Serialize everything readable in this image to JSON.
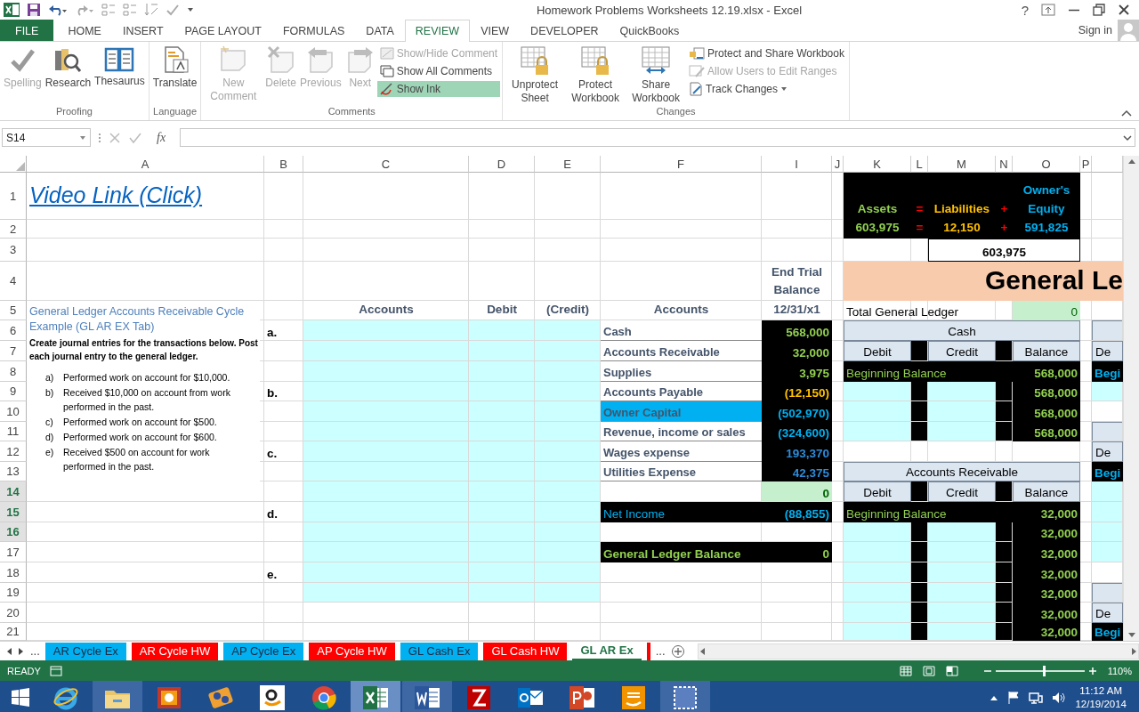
{
  "title_bar": {
    "title": "Homework Problems Worksheets 12.19.xlsx - Excel",
    "help": "?"
  },
  "tabs": [
    {
      "label": "FILE",
      "kind": "file",
      "selected": false
    },
    {
      "label": "HOME",
      "kind": "tab",
      "selected": false
    },
    {
      "label": "INSERT",
      "kind": "tab",
      "selected": false
    },
    {
      "label": "PAGE LAYOUT",
      "kind": "tab",
      "selected": false
    },
    {
      "label": "FORMULAS",
      "kind": "tab",
      "selected": false
    },
    {
      "label": "DATA",
      "kind": "tab",
      "selected": false
    },
    {
      "label": "REVIEW",
      "kind": "tab",
      "selected": true
    },
    {
      "label": "VIEW",
      "kind": "tab",
      "selected": false
    },
    {
      "label": "DEVELOPER",
      "kind": "tab",
      "selected": false
    },
    {
      "label": "QuickBooks",
      "kind": "tab",
      "selected": false
    }
  ],
  "account": {
    "sign_in": "Sign in"
  },
  "ribbon_groups": [
    {
      "label": "Proofing",
      "items": [
        {
          "kind": "large",
          "label": "Spelling",
          "disabled": true
        },
        {
          "kind": "large",
          "label": "Research",
          "disabled": false
        },
        {
          "kind": "large",
          "label": "Thesaurus",
          "disabled": false
        }
      ]
    },
    {
      "label": "Language",
      "items": [
        {
          "kind": "large",
          "label": "Translate",
          "disabled": false
        }
      ]
    },
    {
      "label": "Comments",
      "items": [
        {
          "kind": "large",
          "label": "New Comment",
          "disabled": true
        },
        {
          "kind": "large",
          "label": "Delete",
          "disabled": true
        },
        {
          "kind": "large",
          "label": "Previous",
          "disabled": true
        },
        {
          "kind": "large",
          "label": "Next",
          "disabled": true
        },
        {
          "kind": "stack",
          "items": [
            {
              "label": "Show/Hide Comment",
              "disabled": true,
              "selected": false
            },
            {
              "label": "Show All Comments",
              "disabled": false,
              "selected": false
            },
            {
              "label": "Show Ink",
              "disabled": false,
              "selected": true
            }
          ]
        }
      ]
    },
    {
      "label": "Changes",
      "items": [
        {
          "kind": "large",
          "label": "Unprotect Sheet",
          "disabled": false
        },
        {
          "kind": "large",
          "label": "Protect Workbook",
          "disabled": false
        },
        {
          "kind": "large",
          "label": "Share Workbook",
          "disabled": false
        },
        {
          "kind": "stack",
          "items": [
            {
              "label": "Protect and Share Workbook",
              "disabled": false,
              "selected": false
            },
            {
              "label": "Allow Users to Edit Ranges",
              "disabled": true,
              "selected": false
            },
            {
              "label": "Track Changes",
              "disabled": false,
              "selected": false,
              "dropdown": true
            }
          ]
        }
      ]
    }
  ],
  "formula_bar": {
    "name_box": "S14",
    "function_label": "fx"
  },
  "sheet": {
    "columns": [
      "A",
      "B",
      "C",
      "D",
      "E",
      "F",
      "I",
      "J",
      "K",
      "L",
      "M",
      "N",
      "O",
      "P"
    ],
    "rows": [
      {
        "label": "1",
        "selected": false
      },
      {
        "label": "2",
        "selected": false
      },
      {
        "label": "3",
        "selected": false
      },
      {
        "label": "4",
        "selected": false
      },
      {
        "label": "5",
        "selected": false
      },
      {
        "label": "6",
        "selected": false
      },
      {
        "label": "7",
        "selected": false
      },
      {
        "label": "8",
        "selected": false
      },
      {
        "label": "9",
        "selected": false
      },
      {
        "label": "10",
        "selected": false
      },
      {
        "label": "11",
        "selected": false
      },
      {
        "label": "12",
        "selected": false
      },
      {
        "label": "13",
        "selected": false
      },
      {
        "label": "14",
        "selected": true
      },
      {
        "label": "15",
        "selected": true
      },
      {
        "label": "16",
        "selected": true
      },
      {
        "label": "17",
        "selected": false
      },
      {
        "label": "18",
        "selected": false
      },
      {
        "label": "19",
        "selected": false
      },
      {
        "label": "20",
        "selected": false
      },
      {
        "label": "21",
        "selected": false
      }
    ],
    "video_link": "Video Link (Click)",
    "text_box": {
      "title": "General Ledger Accounts Receivable Cycle Example (GL AR EX Tab)",
      "intro": "Create journal entries for the transactions below. Post each journal entry to the general ledger.",
      "items": [
        {
          "marker": "a)",
          "text": "Performed work on account for $10,000."
        },
        {
          "marker": "b)",
          "text": "Received $10,000 on account from work performed in the past."
        },
        {
          "marker": "c)",
          "text": "Performed work on account for $500."
        },
        {
          "marker": "d)",
          "text": "Performed work on account for $600."
        },
        {
          "marker": "e)",
          "text": "Received $500 on account for work performed in the past."
        }
      ]
    },
    "equation": {
      "terms": [
        {
          "label": "Assets",
          "value": "603,975",
          "kind": "asset"
        },
        {
          "label": "=",
          "value": "=",
          "kind": "operator"
        },
        {
          "label": "Liabilities",
          "value": "12,150",
          "kind": "liability"
        },
        {
          "label": "+",
          "value": "+",
          "kind": "operator"
        },
        {
          "label": "Owner's Equity",
          "value": "591,825",
          "kind": "equity"
        }
      ],
      "total": "603,975"
    },
    "journal": {
      "headers": [
        "Accounts",
        "Debit",
        "(Credit)"
      ],
      "entries": [
        "a.",
        "b.",
        "c.",
        "d.",
        "e."
      ]
    },
    "trial_balance": {
      "title": "End Trial Balance",
      "accounts_header": "Accounts",
      "date": "12/31/x1",
      "accounts": [
        {
          "name": "Cash",
          "amount": "568,000",
          "kind": "asset",
          "highlighted": false
        },
        {
          "name": "Accounts Receivable",
          "amount": "32,000",
          "kind": "asset",
          "highlighted": false
        },
        {
          "name": "Supplies",
          "amount": "3,975",
          "kind": "asset",
          "highlighted": false
        },
        {
          "name": "Accounts Payable",
          "amount": "(12,150)",
          "kind": "liability",
          "highlighted": false
        },
        {
          "name": "Owner Capital",
          "amount": "(502,970)",
          "kind": "equity",
          "highlighted": true
        },
        {
          "name": "Revenue, income or sales",
          "amount": "(324,600)",
          "kind": "equity",
          "highlighted": false
        },
        {
          "name": "Wages expense",
          "amount": "193,370",
          "kind": "expense",
          "highlighted": false
        },
        {
          "name": "Utilities Expense",
          "amount": "42,375",
          "kind": "expense",
          "highlighted": false
        }
      ],
      "check": "0",
      "net_income": {
        "label": "Net Income",
        "amount": "(88,855)"
      },
      "balance": {
        "label": "General Ledger Balance",
        "amount": "0"
      }
    },
    "ledger": {
      "title": "General Le",
      "total_label": "Total General Ledger",
      "total": "0",
      "accounts": [
        {
          "name": "Cash",
          "columns": [
            "Debit",
            "Credit",
            "Balance"
          ],
          "opening_label": "Beginning Balance",
          "balances": [
            "568,000",
            "568,000",
            "568,000",
            "568,000"
          ]
        },
        {
          "name": "Accounts Receivable",
          "columns": [
            "Debit",
            "Credit",
            "Balance"
          ],
          "opening_label": "Beginning Balance",
          "balances": [
            "32,000",
            "32,000",
            "32,000",
            "32,000",
            "32,000",
            "32,000",
            "32,000"
          ]
        }
      ],
      "edge_cells": [
        {
          "kind": "header"
        },
        {
          "kind": "column",
          "text": "De"
        },
        {
          "kind": "opening",
          "text": "Begi"
        },
        {
          "kind": "input"
        },
        {
          "kind": "empty"
        },
        {
          "kind": "header"
        },
        {
          "kind": "column",
          "text": "De"
        },
        {
          "kind": "opening",
          "text": "Begi"
        },
        {
          "kind": "input"
        },
        {
          "kind": "input"
        },
        {
          "kind": "input"
        },
        {
          "kind": "input"
        },
        {
          "kind": "empty"
        },
        {
          "kind": "header"
        },
        {
          "kind": "column",
          "text": "De"
        },
        {
          "kind": "opening",
          "text": "Begi"
        }
      ]
    }
  },
  "sheet_tabs": {
    "overflow_left": "...",
    "overflow_right": "...",
    "tabs": [
      {
        "label": "AR Cycle Ex",
        "color": "#00b0f0",
        "selected": false
      },
      {
        "label": "AR Cycle HW",
        "color": "#ff0000",
        "selected": false
      },
      {
        "label": "AP Cycle Ex",
        "color": "#00b0f0",
        "selected": false
      },
      {
        "label": "AP Cycle HW",
        "color": "#ff0000",
        "selected": false
      },
      {
        "label": "GL Cash Ex",
        "color": "#00b0f0",
        "selected": false
      },
      {
        "label": "GL Cash HW",
        "color": "#ff0000",
        "selected": false
      },
      {
        "label": "GL AR Ex",
        "selected": true
      },
      {
        "color": "#ff0000",
        "selected": false
      }
    ]
  },
  "status_bar": {
    "status": "READY",
    "zoom": {
      "level": 0.55,
      "reading": "110%"
    }
  },
  "taskbar": {
    "apps": [
      {
        "kind": "ie",
        "selected": false,
        "running": false
      },
      {
        "kind": "folder",
        "selected": false,
        "running": true
      },
      {
        "kind": "photo",
        "selected": false,
        "running": false
      },
      {
        "kind": "film",
        "selected": false,
        "running": false
      },
      {
        "kind": "store",
        "selected": false,
        "running": false
      },
      {
        "kind": "chrome",
        "selected": false,
        "running": false
      },
      {
        "kind": "sheet",
        "selected": true,
        "running": true
      },
      {
        "kind": "doc",
        "selected": false,
        "running": true
      },
      {
        "kind": "ftp",
        "selected": false,
        "running": false
      },
      {
        "kind": "mail",
        "selected": false,
        "running": false
      },
      {
        "kind": "slides",
        "selected": false,
        "running": false
      },
      {
        "kind": "store2",
        "selected": false,
        "running": false
      },
      {
        "kind": "snip",
        "selected": false,
        "running": true
      }
    ],
    "time": "11:12 AM",
    "date": "12/19/2014"
  }
}
